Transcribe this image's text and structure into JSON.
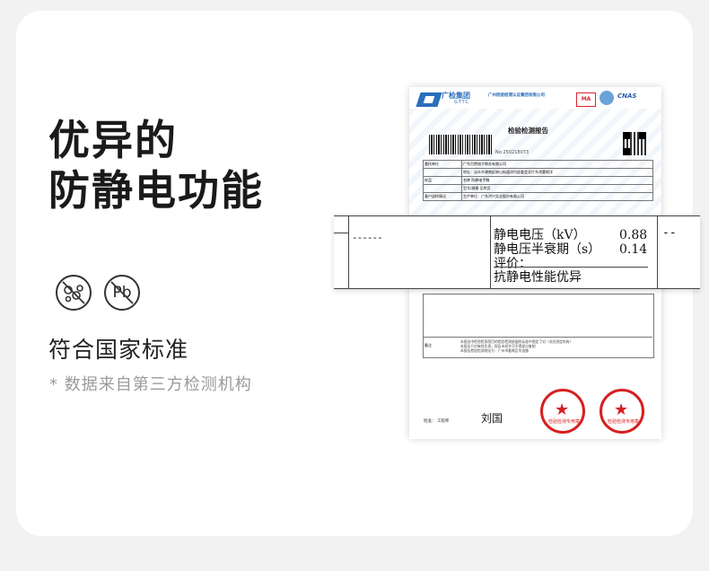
{
  "headline": {
    "line1": "优异的",
    "line2": "防静电功能"
  },
  "icons": [
    {
      "name": "no-phthalates-icon"
    },
    {
      "name": "no-lead-icon",
      "text": "Pb"
    }
  ],
  "standard": "符合国家标准",
  "note": "* 数据来自第三方检测机构",
  "report": {
    "org_name": "广检集团",
    "org_en": "GTTC",
    "org_full": "广州检验检测认证集团有限公司",
    "title": "检验检测报告",
    "report_no": "No:250218073",
    "ma_mark": "MA",
    "cnas": "CNAS",
    "table_rows": [
      {
        "label": "委托单位",
        "value": "广东百赞电子商务有限公司"
      },
      {
        "label": "",
        "value": "地址：汕头市潮南区峡山街道洋内居委会北片东鸿桑地洋"
      },
      {
        "label": "样品",
        "value": "名称  防静电手腕"
      },
      {
        "label": "",
        "value": "型号/规格  见附页"
      },
      {
        "label": "客户送样情况",
        "value": "生产单位：广东洪兴实业股份有限公司"
      }
    ],
    "remark_label": "备注",
    "remark_text": [
      "本报告中检验检测项目的检验检测依据的标准中规定了对（对应测定的有）",
      "本报告只对来样负责，报告未经许可不得部分复制",
      "本报告检验检测地址为：广州市番禺区华创路"
    ],
    "seal1": "检验检测专用章",
    "seal2": "检验检测专用章",
    "approver_label": "批准：",
    "approver_title": "工程师",
    "signature": "刘国"
  },
  "overlay": {
    "dash_left": "------",
    "dash_right": "--",
    "rows": [
      {
        "label": "静电电压（kV）",
        "value": "0.88"
      },
      {
        "label": "静电压半衰期（s）",
        "value": "0.14"
      },
      {
        "label": "评价：",
        "value": ""
      },
      {
        "label": "抗静电性能优异",
        "value": ""
      }
    ]
  }
}
